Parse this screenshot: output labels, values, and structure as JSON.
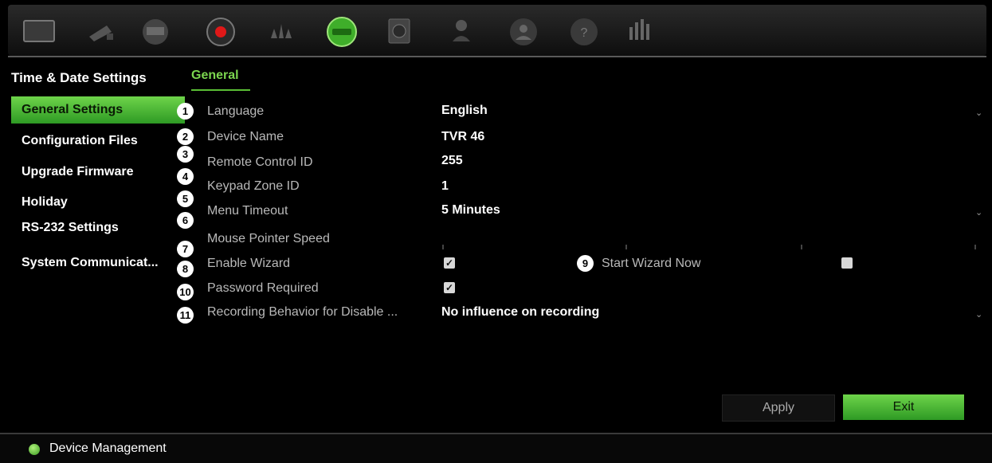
{
  "toolbar": {
    "icons": [
      "monitor-icon",
      "camera-icon",
      "display-icon",
      "record-icon",
      "alarm-icon",
      "device-icon",
      "storage-icon",
      "user-icon",
      "network-icon",
      "help-icon",
      "exit-icon"
    ],
    "active_icon": "device-icon"
  },
  "sidebar": {
    "header": "Time & Date Settings",
    "items": [
      {
        "label": "General Settings",
        "active": true
      },
      {
        "label": "Configuration Files"
      },
      {
        "label": "Upgrade Firmware"
      },
      {
        "label": "Holiday"
      },
      {
        "label": "RS-232 Settings"
      },
      {
        "label": "System Communicat..."
      }
    ]
  },
  "tab": {
    "label": "General"
  },
  "rows": {
    "language": {
      "num": "1",
      "label": "Language",
      "value": "English"
    },
    "device_name": {
      "num": "2",
      "label": "Device Name",
      "value": "TVR 46"
    },
    "remote_control_id": {
      "num": "3",
      "label": "Remote Control ID",
      "value": "255"
    },
    "keypad_zone_id": {
      "num": "4",
      "label": "Keypad Zone ID",
      "value": "1"
    },
    "menu_timeout": {
      "num": "5",
      "label": "Menu Timeout",
      "value": "5 Minutes"
    },
    "mouse_pointer_speed": {
      "num": "6",
      "label": "Mouse Pointer Speed"
    },
    "enable_wizard": {
      "num": "8",
      "label": "Enable Wizard",
      "checked": true
    },
    "start_wizard_now": {
      "num": "9",
      "label": "Start Wizard Now",
      "checked": false
    },
    "password_required": {
      "num": "10",
      "label": "Password Required",
      "checked": true
    },
    "recording_behavior": {
      "num": "11",
      "label": "Recording Behavior for Disable ...",
      "value": "No influence on recording"
    },
    "extra_num": "7"
  },
  "buttons": {
    "apply": "Apply",
    "exit": "Exit"
  },
  "status": {
    "title": "Device Management"
  },
  "colors": {
    "accent": "#5bbf35",
    "background": "#000000"
  }
}
